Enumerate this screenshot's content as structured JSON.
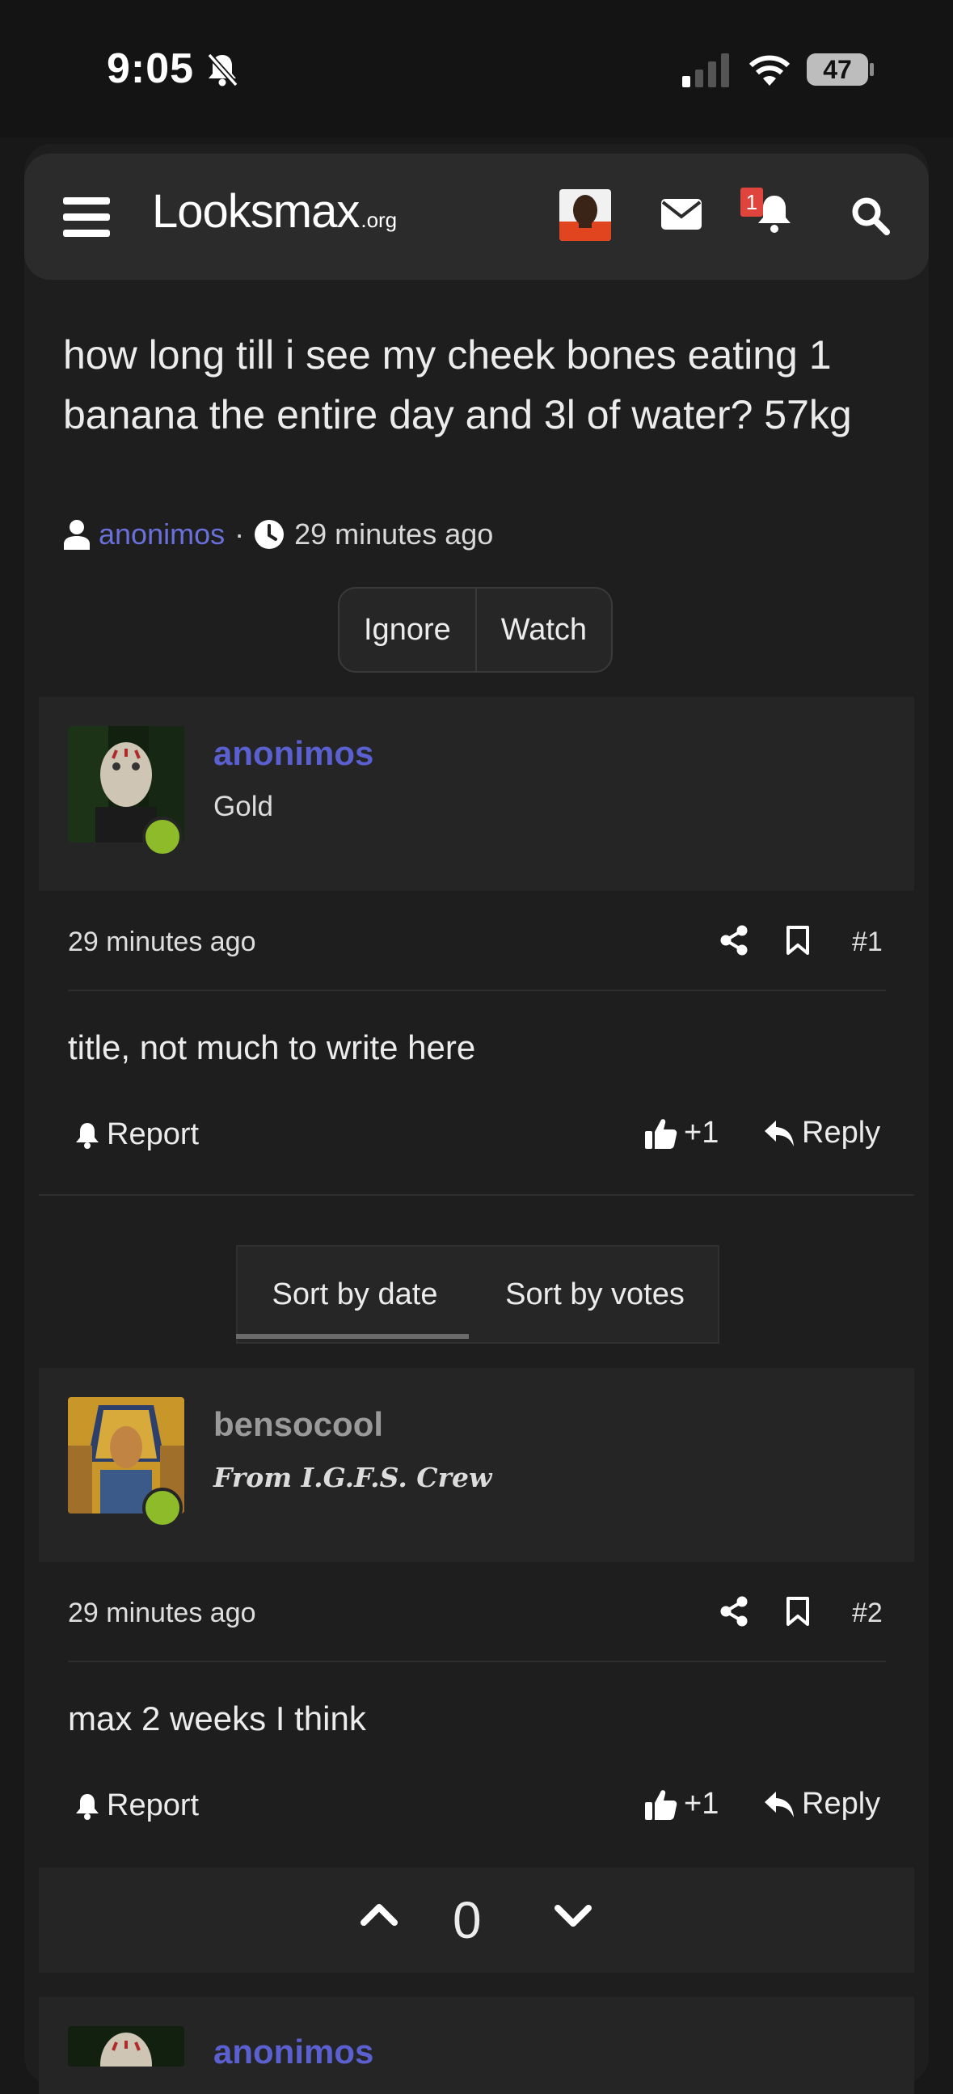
{
  "status_bar": {
    "time": "9:05",
    "battery": "47"
  },
  "header": {
    "logo_main": "Looksmax",
    "logo_suffix": ".org",
    "notification_count": "1"
  },
  "thread": {
    "title": "how long till i see my cheek bones eating 1 banana the entire day and 3l of water? 57kg",
    "author": "anonimos",
    "time": "29 minutes ago",
    "ignore_label": "Ignore",
    "watch_label": "Watch"
  },
  "posts": [
    {
      "username": "anonimos",
      "user_title": "Gold",
      "time": "29 minutes ago",
      "number": "#1",
      "body": "title, not much to write here",
      "report_label": "Report",
      "reaction": "+1",
      "reply_label": "Reply"
    },
    {
      "username": "bensocool",
      "user_title": "From I.G.F.S. Crew",
      "time": "29 minutes ago",
      "number": "#2",
      "body": "max 2 weeks I think",
      "report_label": "Report",
      "reaction": "+1",
      "reply_label": "Reply"
    }
  ],
  "sort": {
    "by_date": "Sort by date",
    "by_votes": "Sort by votes",
    "active": "by_date"
  },
  "vote": {
    "score": "0"
  },
  "next_post": {
    "username": "anonimos"
  },
  "colors": {
    "link": "#5a60d0",
    "online": "#8dbb29",
    "badge": "#e0453d"
  }
}
